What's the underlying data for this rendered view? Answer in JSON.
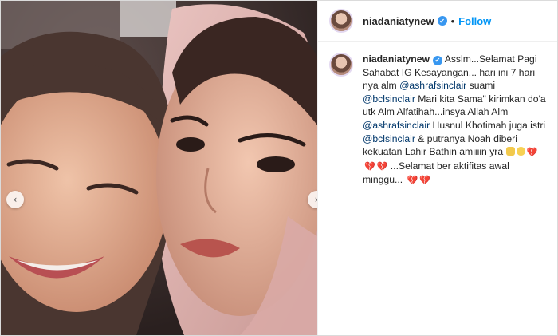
{
  "post": {
    "username": "niadaniatynew",
    "follow_label": "Follow",
    "separator": "•",
    "verified_glyph": "✔",
    "nav_left": "‹",
    "nav_right": "›",
    "caption": {
      "t1": "Asslm...Selamat Pagi Sahabat IG Kesayangan... hari ini 7 hari nya alm ",
      "m1": "@ashrafsinclair",
      "t2": " suami ",
      "m2": "@bclsinclair",
      "t3": " Mari kita Sama\" kirimkan do'a utk Alm Alfatihah...insya Allah Alm ",
      "m3": "@ashrafsinclair",
      "t4": " Husnul Khotimah juga istri ",
      "m4": "@bclsinclair",
      "t5": " & putranya Noah diberi kekuatan Lahir Bathin amiiiin yra ",
      "t6": " ...Selamat ber aktifitas awal minggu... ",
      "heart": "💔"
    },
    "icons": [
      "avatar",
      "verified-badge-icon",
      "chevron-left-icon",
      "chevron-right-icon",
      "prayer-emoji-icon",
      "smile-emoji-icon",
      "broken-heart-icon"
    ]
  },
  "colors": {
    "link": "#0095f6",
    "mention": "#00376b",
    "verified": "#3897f0"
  }
}
